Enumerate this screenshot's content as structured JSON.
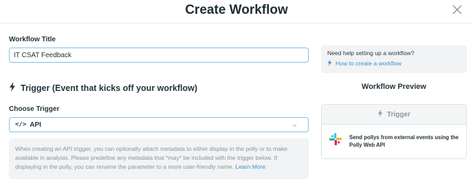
{
  "header": {
    "title": "Create Workflow"
  },
  "workflow_title": {
    "label": "Workflow Title",
    "value": "IT CSAT Feedback"
  },
  "trigger_section": {
    "heading": "Trigger (Event that kicks off your workflow)",
    "choose_label": "Choose Trigger",
    "selected_trigger": "API",
    "info_text": "When creating an API trigger, you can optionally attach metadata to either display in the polly or to make available in analysis. Please predefine any metadata that *may* be included with the trigger below. If displaying in the polly, you can rename the parameter to a more user-friendly name.",
    "info_link": "Learn More"
  },
  "help": {
    "question": "Need help setting up a workflow?",
    "link": "How to create a workflow"
  },
  "preview": {
    "title": "Workflow Preview",
    "card_header": "Trigger",
    "card_text": "Send pollys from external events using the Polly Web API"
  },
  "icons": {
    "close": "close-icon",
    "bolt": "bolt-icon",
    "code": "code-icon",
    "chevron": "chevron-down-icon",
    "slack": "slack-logo-icon"
  },
  "colors": {
    "accent": "#3d8fcf",
    "input_border": "#7fc2e8",
    "panel_bg": "#f1f3f4"
  }
}
